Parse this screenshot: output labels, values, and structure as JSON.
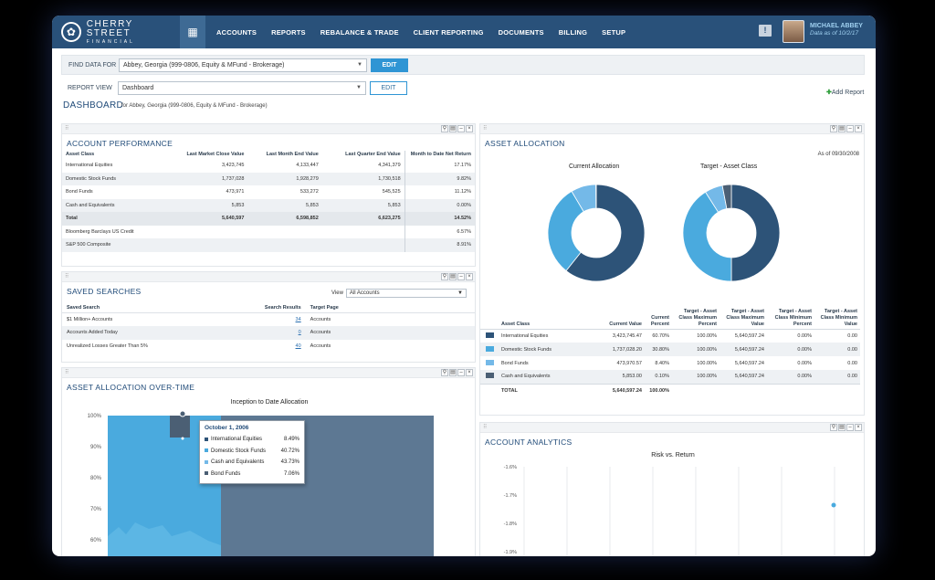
{
  "brand": {
    "name": "CHERRY STREET",
    "tagline": "FINANCIAL"
  },
  "nav": {
    "items": [
      "ACCOUNTS",
      "REPORTS",
      "REBALANCE & TRADE",
      "CLIENT REPORTING",
      "DOCUMENTS",
      "BILLING",
      "SETUP"
    ]
  },
  "user": {
    "name": "MICHAEL ABBEY",
    "date": "Data as of 10/2/17"
  },
  "find": {
    "label": "FIND DATA FOR",
    "value": "Abbey, Georgia (999-0806, Equity & MFund - Brokerage)",
    "button": "EDIT"
  },
  "report": {
    "label": "REPORT VIEW",
    "value": "Dashboard",
    "button": "EDIT",
    "add": "Add Report"
  },
  "dashboard": {
    "title": "DASHBOARD",
    "subtitle": "for Abbey, Georgia (999-0806, Equity & MFund - Brokerage)"
  },
  "performance": {
    "title": "ACCOUNT PERFORMANCE",
    "headers": [
      "Asset Class",
      "Last Market Close Value",
      "Last Month End Value",
      "Last Quarter End Value",
      "Month to Date Net Return"
    ],
    "rows": [
      [
        "International Equities",
        "3,423,745",
        "4,133,447",
        "4,341,379",
        "17.17%"
      ],
      [
        "Domestic Stock Funds",
        "1,737,028",
        "1,928,279",
        "1,730,518",
        "9.82%"
      ],
      [
        "Bond Funds",
        "473,971",
        "533,272",
        "545,525",
        "11.12%"
      ],
      [
        "Cash and Equivalents",
        "5,853",
        "5,853",
        "5,853",
        "0.00%"
      ],
      [
        "Total",
        "5,640,597",
        "6,598,852",
        "6,623,275",
        "14.52%"
      ],
      [
        "Bloomberg Barclays US Credit",
        "",
        "",
        "",
        "6.57%"
      ],
      [
        "S&P 500 Composite",
        "",
        "",
        "",
        "8.91%"
      ]
    ]
  },
  "saved": {
    "title": "SAVED SEARCHES",
    "view_label": "View",
    "view_value": "All Accounts",
    "headers": [
      "Saved Search",
      "Search Results",
      "Target Page"
    ],
    "rows": [
      [
        "$1 Million+ Accounts",
        "34",
        "Accounts"
      ],
      [
        "Accounts Added Today",
        "0",
        "Accounts"
      ],
      [
        "Unrealized Losses Greater Than 5%",
        "40",
        "Accounts"
      ]
    ]
  },
  "overtime": {
    "title": "ASSET ALLOCATION OVER-TIME",
    "chart_title": "Inception to Date Allocation",
    "tooltip": {
      "date": "October 1, 2006",
      "rows": [
        [
          "International Equities",
          "8.49%"
        ],
        [
          "Domestic Stock Funds",
          "40.72%"
        ],
        [
          "Cash and Equivalents",
          "43.73%"
        ],
        [
          "Bond Funds",
          "7.06%"
        ]
      ]
    }
  },
  "allocation": {
    "title": "ASSET ALLOCATION",
    "as_of": "As of 09/30/2008",
    "current_label": "Current Allocation",
    "target_label": "Target - Asset Class",
    "headers": [
      "Asset Class",
      "Current Value",
      "Current Percent",
      "Target - Asset Class Maximum Percent",
      "Target - Asset Class Maximum Value",
      "Target - Asset Class Minimum Percent",
      "Target - Asset Class Minimum Value"
    ],
    "rows": [
      [
        "International Equities",
        "3,423,745.47",
        "60.70%",
        "100.00%",
        "5,640,597.24",
        "0.00%",
        "0.00"
      ],
      [
        "Domestic Stock Funds",
        "1,737,028.20",
        "30.80%",
        "100.00%",
        "5,640,597.24",
        "0.00%",
        "0.00"
      ],
      [
        "Bond Funds",
        "473,970.57",
        "8.40%",
        "100.00%",
        "5,640,597.24",
        "0.00%",
        "0.00"
      ],
      [
        "Cash and Equivalents",
        "5,853.00",
        "0.10%",
        "100.00%",
        "5,640,597.24",
        "0.00%",
        "0.00"
      ]
    ],
    "total": [
      "TOTAL",
      "5,640,597.24",
      "100.00%"
    ],
    "colors": [
      "#2d5378",
      "#4aaade",
      "#74b9e8",
      "#4b5f74"
    ]
  },
  "analytics": {
    "title": "ACCOUNT ANALYTICS",
    "chart_title": "Risk vs. Return"
  },
  "chart_data": [
    {
      "type": "pie",
      "title": "Current Allocation",
      "categories": [
        "International Equities",
        "Domestic Stock Funds",
        "Bond Funds",
        "Cash and Equivalents"
      ],
      "values": [
        60.7,
        30.8,
        8.4,
        0.1
      ]
    },
    {
      "type": "pie",
      "title": "Target - Asset Class",
      "categories": [
        "International Equities",
        "Domestic Stock Funds",
        "Bond Funds",
        "Cash and Equivalents"
      ],
      "values": [
        50,
        41,
        6,
        3
      ]
    },
    {
      "type": "area",
      "title": "Inception to Date Allocation",
      "ylim": [
        60,
        100
      ],
      "yticks": [
        "100%",
        "90%",
        "80%",
        "70%",
        "60%"
      ]
    },
    {
      "type": "scatter",
      "title": "Risk vs. Return",
      "yticks": [
        "-1.6%",
        "-1.7%",
        "-1.8%",
        "-1.9%"
      ],
      "x": [
        1
      ],
      "y": [
        -1.75
      ]
    }
  ]
}
